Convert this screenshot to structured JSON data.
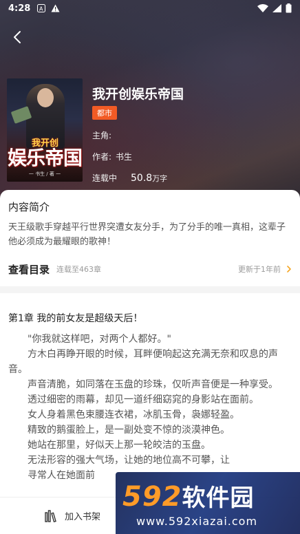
{
  "status_bar": {
    "time": "4:28"
  },
  "book": {
    "title": "我开创娱乐帝国",
    "genre": "都市",
    "protagonist_label": "主角:",
    "protagonist_value": "",
    "author_label": "作者:",
    "author_value": "书生",
    "status": "连载中",
    "word_count": "50.8",
    "word_unit": "万字",
    "cover_art_text": "娱乐帝国",
    "cover_art_small": "我开创",
    "cover_art_author": "一 书生 / 著 一"
  },
  "intro": {
    "heading": "内容简介",
    "text": "天王级歌手穿越平行世界突遭女友分手，为了分手的唯一真相，这辈子他必须成为最耀眼的歌神！"
  },
  "toc": {
    "label": "查看目录",
    "progress": "连载至463章",
    "updated": "更新于1年前"
  },
  "chapter": {
    "title": "第1章  我的前女友是超级天后！",
    "paragraphs": [
      " \"你我就这样吧，对两个人都好。\"",
      "方木白再睁开眼的时候，耳畔便响起这充满无奈和叹息的声音。",
      "声音清脆，如同落在玉盘的珍珠，仅听声音便是一种享受。",
      "透过细密的雨幕，却见一道纤细窈窕的身影站在面前。",
      "女人身着黑色束腰连衣裙，冰肌玉骨，袅娜轻盈。",
      "精致的鹅蛋脸上，是一副处变不惊的淡漠神色。",
      "她站在那里，好似天上那一轮皎洁的玉盘。",
      "无法形容的强大气场，让她的地位高不可攀，让",
      "寻常人在她面前"
    ]
  },
  "bottom_bar": {
    "add_shelf": "加入书架"
  },
  "watermark": {
    "brand_num": "592",
    "brand_cn": "软件园",
    "url": "www.592xiazai.com"
  },
  "colors": {
    "accent": "#f25b25",
    "toc_arrow": "#f5a623",
    "watermark_orange": "#ff9b28"
  }
}
